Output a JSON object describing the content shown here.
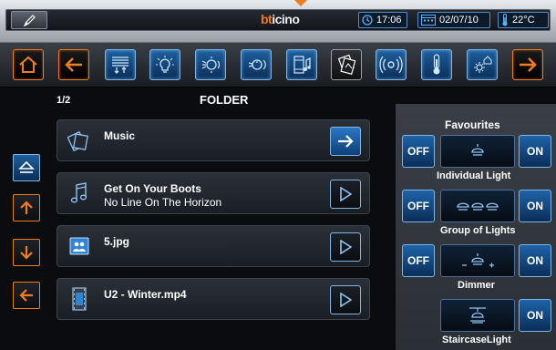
{
  "header": {
    "brand_prefix": "bt",
    "brand_suffix": "icino",
    "time": "17:06",
    "date": "02/07/10",
    "temperature": "22°C",
    "edit_icon": "pencil-icon"
  },
  "toolbar": {
    "items": [
      {
        "name": "home-icon",
        "style": "orange"
      },
      {
        "name": "back-icon",
        "style": "orange"
      },
      {
        "name": "shutters-icon",
        "style": "blue"
      },
      {
        "name": "light-bulb-icon",
        "style": "blue"
      },
      {
        "name": "light-scenario-icon",
        "style": "blue"
      },
      {
        "name": "dimmer-icon",
        "style": "blue"
      },
      {
        "name": "multimedia-icon",
        "style": "blue"
      },
      {
        "name": "photo-album-icon",
        "style": "dark"
      },
      {
        "name": "wireless-icon",
        "style": "blue"
      },
      {
        "name": "thermometer-icon",
        "style": "blue"
      },
      {
        "name": "house-settings-icon",
        "style": "blue"
      },
      {
        "name": "forward-icon",
        "style": "orange"
      }
    ]
  },
  "browser": {
    "page_indicator": "1/2",
    "title": "FOLDER",
    "items": [
      {
        "title": "Music",
        "subtitle": "",
        "icon": "folder-icon",
        "action": "open-arrow"
      },
      {
        "title": "Get On Your Boots",
        "subtitle": "No Line On The Horizon",
        "icon": "music-note-icon",
        "action": "play"
      },
      {
        "title": "5.jpg",
        "subtitle": "",
        "icon": "image-icon",
        "action": "play"
      },
      {
        "title": "U2 - Winter.mp4",
        "subtitle": "",
        "icon": "video-icon",
        "action": "play"
      }
    ]
  },
  "favourites": {
    "title": "Favourites",
    "off_label": "OFF",
    "on_label": "ON",
    "items": [
      {
        "label": "Individual Light",
        "icon": "single-lamp-icon",
        "has_off": true
      },
      {
        "label": "Group of Lights",
        "icon": "lamp-group-icon",
        "has_off": true
      },
      {
        "label": "Dimmer",
        "icon": "dimmer-lamp-icon",
        "has_off": true
      },
      {
        "label": "StaircaseLight",
        "icon": "staircase-light-icon",
        "has_off": false
      }
    ]
  },
  "colors": {
    "accent_orange": "#f07c1e",
    "accent_blue": "#1e63a8",
    "panel_gray": "#343942"
  }
}
